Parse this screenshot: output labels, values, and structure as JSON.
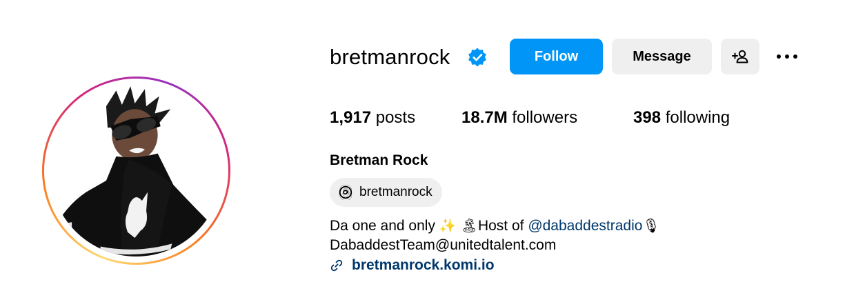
{
  "profile": {
    "username": "bretmanrock",
    "verified_icon": "verified-badge-icon",
    "full_name": "Bretman Rock",
    "avatar_icon": "profile-photo"
  },
  "actions": {
    "follow_label": "Follow",
    "message_label": "Message",
    "add_user_icon": "add-user-icon",
    "more_icon": "more-options-icon"
  },
  "stats": {
    "posts_count": "1,917",
    "posts_label": "posts",
    "followers_count": "18.7M",
    "followers_label": "followers",
    "following_count": "398",
    "following_label": "following"
  },
  "threads": {
    "handle": "bretmanrock",
    "icon": "threads-icon"
  },
  "bio": {
    "line1_prefix": "Da one and only",
    "sparkles_emoji": "✨",
    "island_emoji": "🏝",
    "host_of": "Host of",
    "mention": "@dabaddestradio",
    "mic_emoji": "🎙",
    "line2": "DabaddestTeam@unitedtalent.com"
  },
  "link": {
    "icon": "link-icon",
    "text": "bretmanrock.komi.io"
  },
  "colors": {
    "follow_blue": "#0095f6",
    "secondary_button": "#efefef",
    "link_color": "#00376b",
    "verified_blue": "#0095f6"
  }
}
